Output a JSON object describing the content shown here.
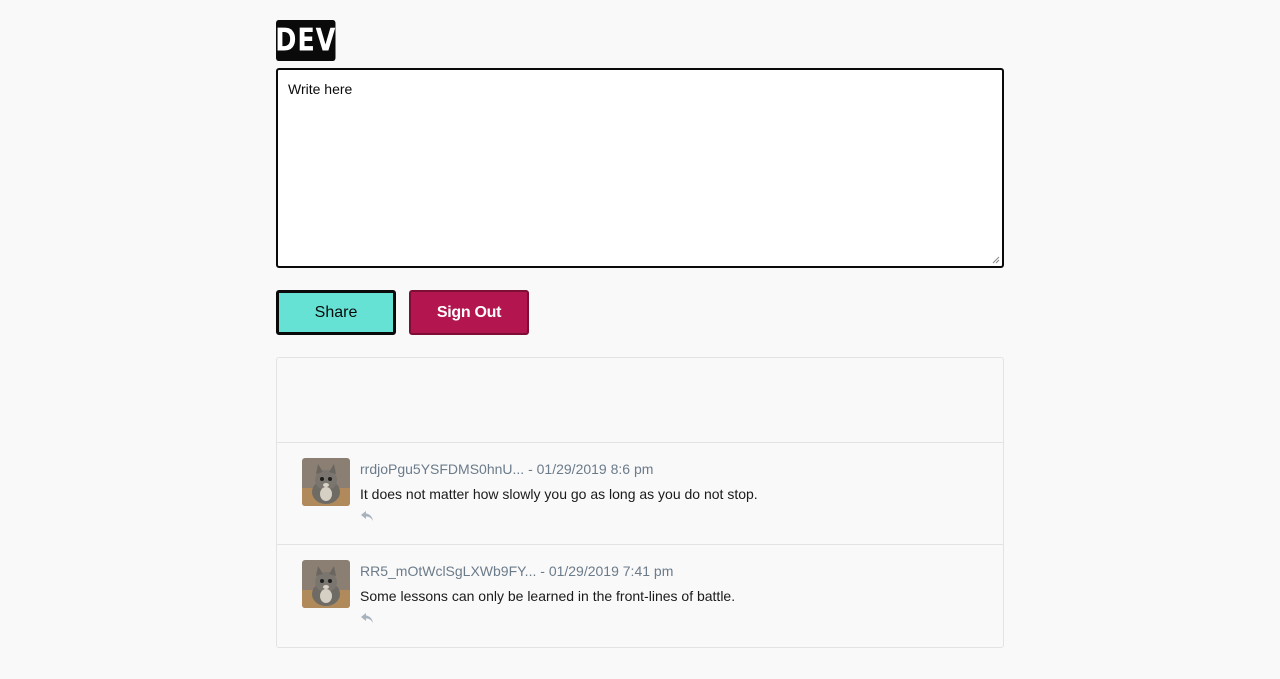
{
  "logo": {
    "text": "DEV"
  },
  "editor": {
    "placeholder": "Write here",
    "value": ""
  },
  "actions": {
    "share_label": "Share",
    "signout_label": "Sign Out"
  },
  "colors": {
    "share_bg": "#66e2d5",
    "signout_bg": "#b3164e",
    "page_bg": "#f9f9f9",
    "meta_text": "#6b7b8a"
  },
  "comments": [
    {
      "user": "rrdjoPgu5YSFDMS0hnU...",
      "separator": "-",
      "timestamp": "01/29/2019 8:6 pm",
      "text": "It does not matter how slowly you go as long as you do not stop.",
      "avatar_icon": "cat-avatar",
      "reply_icon": "reply-icon"
    },
    {
      "user": "RR5_mOtWclSgLXWb9FY...",
      "separator": "-",
      "timestamp": "01/29/2019 7:41 pm",
      "text": "Some lessons can only be learned in the front-lines of battle.",
      "avatar_icon": "cat-avatar",
      "reply_icon": "reply-icon"
    }
  ]
}
